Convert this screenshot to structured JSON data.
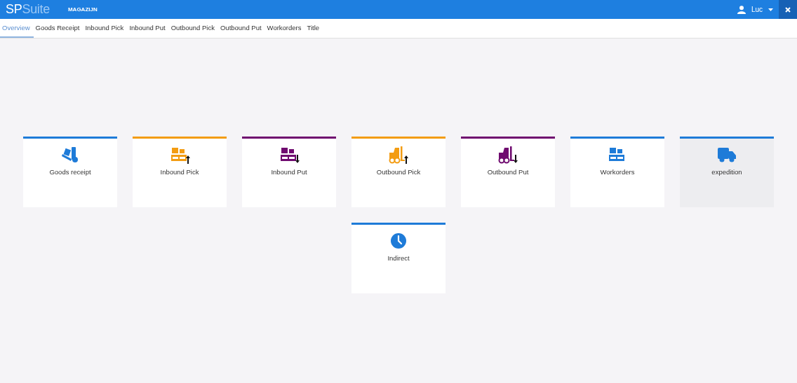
{
  "header": {
    "logo_left": "SP",
    "logo_right": "Suite",
    "section": "MAGAZIJN",
    "user": "Luc"
  },
  "tabs": [
    {
      "label": "Overview",
      "selected": true
    },
    {
      "label": "Goods Receipt",
      "selected": false
    },
    {
      "label": "Inbound Pick",
      "selected": false
    },
    {
      "label": "Inbound Put",
      "selected": false
    },
    {
      "label": "Outbound Pick",
      "selected": false
    },
    {
      "label": "Outbound Put",
      "selected": false
    },
    {
      "label": "Workorders",
      "selected": false
    },
    {
      "label": "Title",
      "selected": false
    }
  ],
  "tile_rows": [
    [
      {
        "label": "Goods receipt",
        "kind": "hand-truck",
        "color": "#1e7bd8",
        "hovered": false
      },
      {
        "label": "Inbound Pick",
        "kind": "pallet-up",
        "color": "#f39c12",
        "hovered": false
      },
      {
        "label": "Inbound Put",
        "kind": "pallet-down",
        "color": "#6f0a6f",
        "hovered": false
      },
      {
        "label": "Outbound Pick",
        "kind": "forklift-up",
        "color": "#f39c12",
        "hovered": false
      },
      {
        "label": "Outbound Put",
        "kind": "forklift-down",
        "color": "#6f0a6f",
        "hovered": false
      },
      {
        "label": "Workorders",
        "kind": "pallet",
        "color": "#1e7bd8",
        "hovered": false
      },
      {
        "label": "expedition",
        "kind": "truck",
        "color": "#1e7bd8",
        "hovered": true
      }
    ],
    [
      {
        "label": "Indirect",
        "kind": "clock",
        "color": "#1e7bd8",
        "hovered": false
      }
    ]
  ]
}
